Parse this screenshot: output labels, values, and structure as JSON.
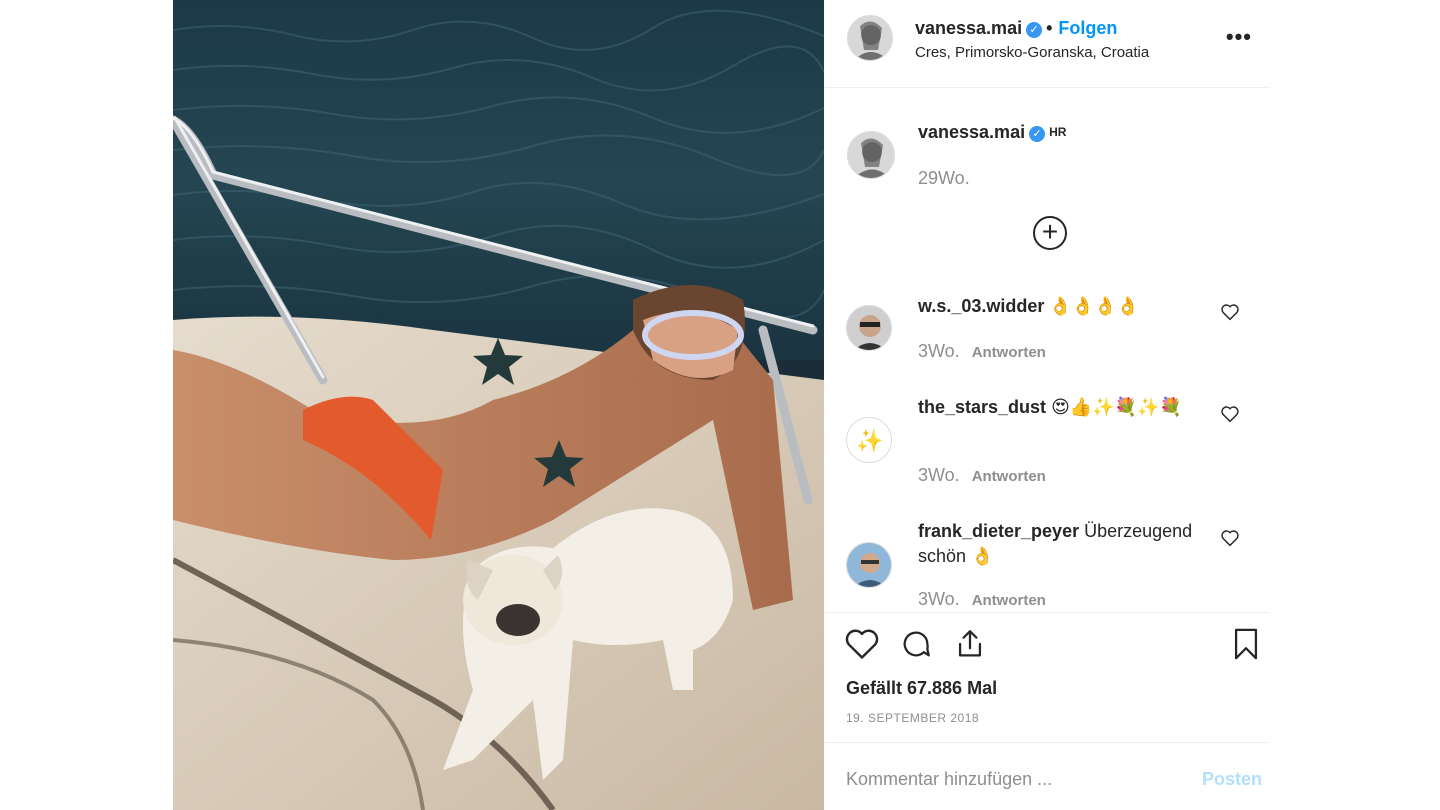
{
  "header": {
    "username": "vanessa.mai",
    "separator": "•",
    "follow_label": "Folgen",
    "location": "Cres, Primorsko-Goranska, Croatia",
    "more_label": "•••"
  },
  "caption": {
    "username": "vanessa.mai",
    "flag": "HR",
    "time": "29Wo."
  },
  "load_more_label": "+",
  "comments": [
    {
      "username": "w.s._03.widder",
      "text": "👌👌👌👌",
      "time": "3Wo.",
      "reply_label": "Antworten"
    },
    {
      "username": "the_stars_dust",
      "text": "😍👍✨💐✨💐",
      "time": "3Wo.",
      "reply_label": "Antworten"
    },
    {
      "username": "frank_dieter_peyer",
      "text": "Überzeugend schön 👌",
      "time": "3Wo.",
      "reply_label": "Antworten"
    }
  ],
  "likes": "Gefällt 67.886 Mal",
  "date": "19. SEPTEMBER 2018",
  "add_comment": {
    "placeholder": "Kommentar hinzufügen ...",
    "post_label": "Posten"
  },
  "colors": {
    "accent": "#0095f6",
    "post_disabled": "#b2dffc",
    "muted": "#8e8e8e",
    "water": "#1f3a48"
  },
  "icons": [
    "more-options-icon",
    "verified-badge-icon",
    "add-comment-icon",
    "heart-icon",
    "comment-icon",
    "share-icon",
    "bookmark-icon"
  ]
}
